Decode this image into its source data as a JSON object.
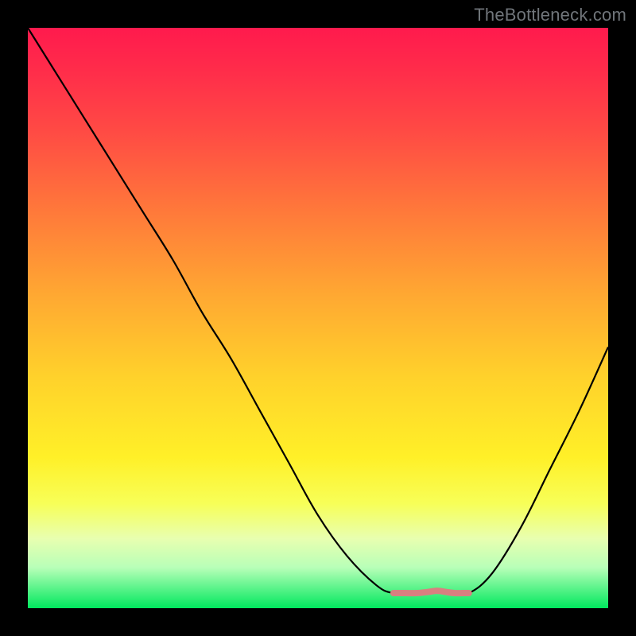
{
  "watermark": "TheBottleneck.com",
  "chart_data": {
    "type": "line",
    "title": "",
    "xlabel": "",
    "ylabel": "",
    "xlim": [
      0,
      100
    ],
    "ylim": [
      0,
      100
    ],
    "series": [
      {
        "name": "curve",
        "x": [
          0,
          5,
          10,
          15,
          20,
          25,
          30,
          35,
          40,
          45,
          50,
          55,
          60,
          63,
          67,
          70,
          73,
          76,
          80,
          85,
          90,
          95,
          100
        ],
        "values": [
          100,
          92,
          84,
          76,
          68,
          60,
          51,
          43,
          34,
          25,
          16,
          9,
          4,
          2.6,
          2.6,
          3,
          2.6,
          2.6,
          6,
          14,
          24,
          34,
          45
        ]
      },
      {
        "name": "flat-highlight",
        "x": [
          63,
          65,
          67,
          69,
          70.5,
          72,
          73.5,
          75,
          76
        ],
        "values": [
          2.6,
          2.6,
          2.6,
          2.8,
          3.0,
          2.8,
          2.6,
          2.6,
          2.6
        ]
      }
    ],
    "colors": {
      "curve": "#000000",
      "flat_highlight": "#d98080",
      "gradient_top": "#ff1a4d",
      "gradient_bottom": "#00e85e"
    }
  }
}
